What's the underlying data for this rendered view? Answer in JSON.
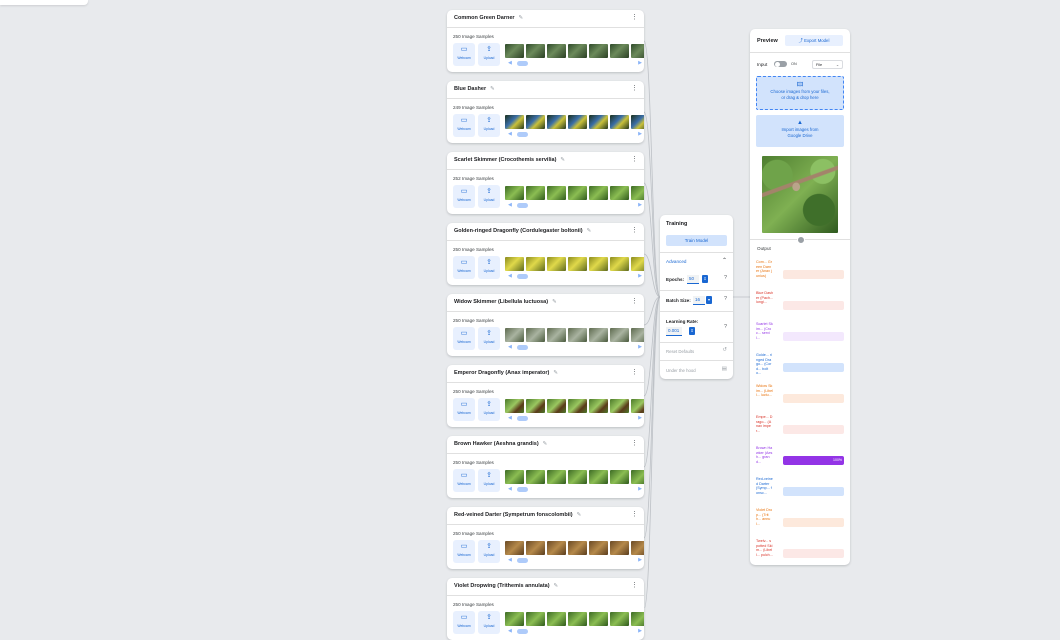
{
  "classes": [
    {
      "name": "Common Green Darner",
      "samples": "250 Image Samples",
      "thumb": "t-dark"
    },
    {
      "name": "Blue Dasher",
      "samples": "249 Image Samples",
      "thumb": "t-blue"
    },
    {
      "name": "Scarlet Skimmer (Crocothemis servilia)",
      "samples": "252 Image Samples",
      "thumb": "t-green"
    },
    {
      "name": "Golden-ringed Dragonfly (Cordulegaster boltonii)",
      "samples": "250 Image Samples",
      "thumb": "t-yellow"
    },
    {
      "name": "Widow Skimmer (Libellula luctuosa)",
      "samples": "250 Image Samples",
      "thumb": "t-gray"
    },
    {
      "name": "Emperor Dragonfly (Anax imperator)",
      "samples": "250 Image Samples",
      "thumb": "t-leaf"
    },
    {
      "name": "Brown Hawker (Aeshna grandis)",
      "samples": "250 Image Samples",
      "thumb": "t-green"
    },
    {
      "name": "Red-veined Darter (Sympetrum fonscolombii)",
      "samples": "250 Image Samples",
      "thumb": "t-brown"
    },
    {
      "name": "Violet Dropwing (Trithemis annulata)",
      "samples": "250 Image Samples",
      "thumb": "t-green"
    }
  ],
  "class_buttons": {
    "webcam": "Webcam",
    "upload": "Upload"
  },
  "icons": {
    "webcam": "webcam-icon",
    "upload": "upload-icon",
    "edit": "pencil-icon",
    "menu": "kebab-menu-icon"
  },
  "training": {
    "title": "Training",
    "train_button": "Train Model",
    "advanced": "Advanced",
    "epochs_label": "Epochs:",
    "epochs_value": "50",
    "batch_label": "Batch Size:",
    "batch_value": "16",
    "lr_label": "Learning Rate:",
    "lr_value": "0.001",
    "reset": "Reset Defaults",
    "under_hood": "Under the hood"
  },
  "preview": {
    "title": "Preview",
    "export": "Export Model",
    "input_label": "Input",
    "toggle_label": "ON",
    "source_select": "File",
    "choose_line1": "Choose images from your files,",
    "choose_line2": "or drag & drop here",
    "drive_line1": "Import images from",
    "drive_line2": "Google Drive",
    "output_label": "Output"
  },
  "outputs": [
    {
      "name": "Com... Green Darner (Anax junius)",
      "color": "#e8710a",
      "track": "#fce8e0",
      "value": 0
    },
    {
      "name": "Blue Dasher (Pach... longi...",
      "color": "#d93025",
      "track": "#fce8e6",
      "value": 0
    },
    {
      "name": "Scarlet Skim... (Croc... servil...",
      "color": "#9334e6",
      "track": "#f3e8fd",
      "value": 0
    },
    {
      "name": "Golde... ringed Drago... (Cord... bolto...",
      "color": "#1967d2",
      "track": "#d2e3fc",
      "value": 0
    },
    {
      "name": "Widow Skim... (Libell... luctu...",
      "color": "#e8710a",
      "track": "#fde9dc",
      "value": 0
    },
    {
      "name": "Empe... Drago... (Anax imper...",
      "color": "#d93025",
      "track": "#fce8e6",
      "value": 0
    },
    {
      "name": "Brown Hawker (Aesh... grand...",
      "color": "#9334e6",
      "track": "#f3e8fd",
      "value": 100,
      "value_label": "100%"
    },
    {
      "name": "Red-veined Darter (Symp... fonsc...",
      "color": "#1967d2",
      "track": "#d2e3fc",
      "value": 0
    },
    {
      "name": "Violet Drop... (Trith... annul...",
      "color": "#e8710a",
      "track": "#fde9dc",
      "value": 0
    },
    {
      "name": "Twelv... spotted Skim... (Libell... pulch...",
      "color": "#d93025",
      "track": "#fce8e6",
      "value": 0
    }
  ]
}
